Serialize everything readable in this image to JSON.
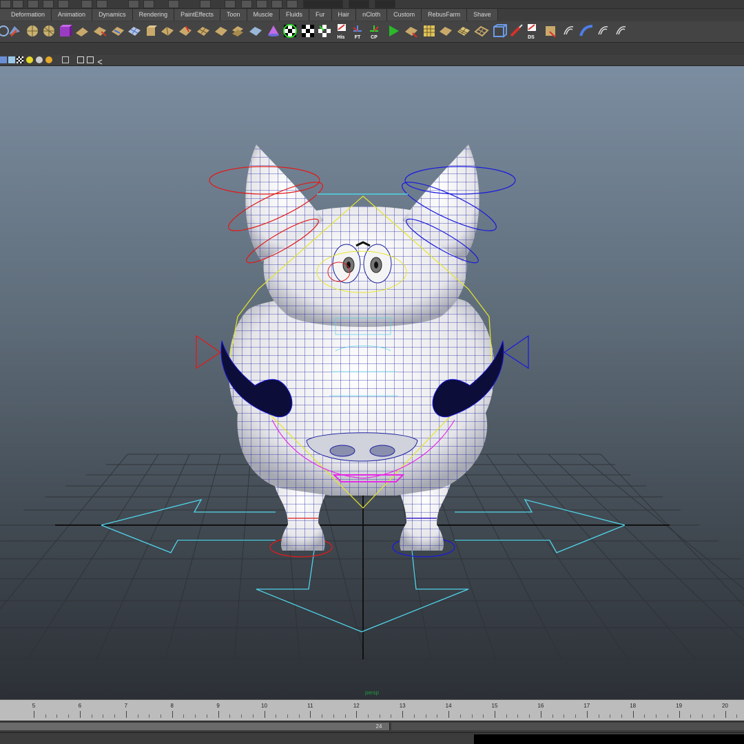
{
  "shelf": {
    "tabs": [
      "Deformation",
      "Animation",
      "Dynamics",
      "Rendering",
      "PaintEffects",
      "Toon",
      "Muscle",
      "Fluids",
      "Fur",
      "Hair",
      "nCloth",
      "Custom",
      "RebusFarm",
      "Shave"
    ],
    "icons": [
      {
        "name": "curve-tool-icon",
        "label": ""
      },
      {
        "name": "sphere-icon",
        "label": ""
      },
      {
        "name": "sphere-grid-icon",
        "label": ""
      },
      {
        "name": "cube-icon",
        "label": ""
      },
      {
        "name": "plane-icon",
        "label": ""
      },
      {
        "name": "skin-icon",
        "label": ""
      },
      {
        "name": "deformer-icon",
        "label": ""
      },
      {
        "name": "lattice-icon",
        "label": ""
      },
      {
        "name": "box-icon",
        "label": ""
      },
      {
        "name": "patch-icon",
        "label": ""
      },
      {
        "name": "bend-icon",
        "label": ""
      },
      {
        "name": "surface-icon",
        "label": ""
      },
      {
        "name": "cone-icon",
        "label": ""
      },
      {
        "name": "checker-icon",
        "label": ""
      },
      {
        "name": "checker-cursor-icon",
        "label": ""
      },
      {
        "name": "history-icon",
        "label": "His"
      },
      {
        "name": "freeze-transform-icon",
        "label": "FT"
      },
      {
        "name": "center-pivot-icon",
        "label": "CP"
      },
      {
        "name": "play-icon",
        "label": ""
      },
      {
        "name": "mesh-icon",
        "label": ""
      },
      {
        "name": "grid-icon",
        "label": ""
      },
      {
        "name": "wire-icon",
        "label": ""
      },
      {
        "name": "cage-icon",
        "label": ""
      },
      {
        "name": "paint-icon",
        "label": ""
      },
      {
        "name": "delete-history-icon",
        "label": "DS"
      },
      {
        "name": "save-icon",
        "label": ""
      },
      {
        "name": "hair-icon",
        "label": ""
      },
      {
        "name": "shave-icon",
        "label": ""
      },
      {
        "name": "comb-icon",
        "label": ""
      }
    ]
  },
  "viewport": {
    "camera_label": "persp"
  },
  "timeline": {
    "frames": [
      5,
      6,
      7,
      8,
      9,
      10,
      11,
      12,
      13,
      14,
      15,
      16,
      17,
      18,
      19,
      20
    ]
  },
  "range": {
    "current_frame": "24"
  },
  "colors": {
    "mesh": "#1a1f9e",
    "left_ctrl": "#e01b1b",
    "right_ctrl": "#1b1bde",
    "main_ctrl": "#4fd3e8",
    "spine_ctrl": "#e6e62a",
    "jaw_ctrl": "#e62ae6"
  }
}
